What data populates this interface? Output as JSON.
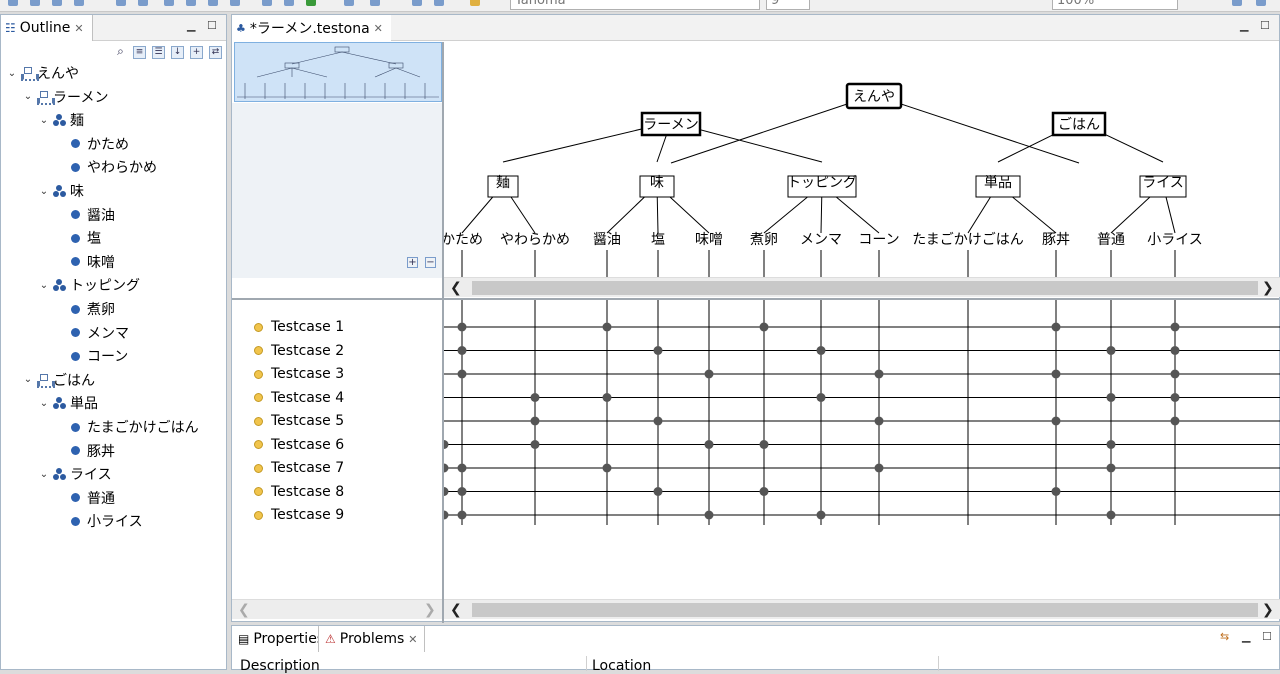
{
  "toolbar": {
    "font_name": "Tahoma",
    "font_size": "9",
    "zoom": "100%"
  },
  "outline": {
    "title": "Outline",
    "tree": [
      {
        "label": "えんや",
        "level": 0,
        "type": "root",
        "expanded": true
      },
      {
        "label": "ラーメン",
        "level": 1,
        "type": "node",
        "expanded": true
      },
      {
        "label": "麺",
        "level": 2,
        "type": "comp",
        "expanded": true
      },
      {
        "label": "かため",
        "level": 3,
        "type": "leaf"
      },
      {
        "label": "やわらかめ",
        "level": 3,
        "type": "leaf"
      },
      {
        "label": "味",
        "level": 2,
        "type": "comp",
        "expanded": true
      },
      {
        "label": "醤油",
        "level": 3,
        "type": "leaf"
      },
      {
        "label": "塩",
        "level": 3,
        "type": "leaf"
      },
      {
        "label": "味噌",
        "level": 3,
        "type": "leaf"
      },
      {
        "label": "トッピング",
        "level": 2,
        "type": "comp",
        "expanded": true
      },
      {
        "label": "煮卵",
        "level": 3,
        "type": "leaf"
      },
      {
        "label": "メンマ",
        "level": 3,
        "type": "leaf"
      },
      {
        "label": "コーン",
        "level": 3,
        "type": "leaf"
      },
      {
        "label": "ごはん",
        "level": 1,
        "type": "node",
        "expanded": true
      },
      {
        "label": "単品",
        "level": 2,
        "type": "comp",
        "expanded": true
      },
      {
        "label": "たまごかけごはん",
        "level": 3,
        "type": "leaf"
      },
      {
        "label": "豚丼",
        "level": 3,
        "type": "leaf"
      },
      {
        "label": "ライス",
        "level": 2,
        "type": "comp",
        "expanded": true
      },
      {
        "label": "普通",
        "level": 3,
        "type": "leaf"
      },
      {
        "label": "小ライス",
        "level": 3,
        "type": "leaf"
      }
    ]
  },
  "editor": {
    "tab_title": "*ラーメン.testona",
    "model": {
      "root": "えんや",
      "groups": [
        {
          "name": "ラーメン",
          "categories": [
            {
              "name": "麺",
              "classes": [
                "かため",
                "やわらかめ"
              ]
            },
            {
              "name": "味",
              "classes": [
                "醤油",
                "塩",
                "味噌"
              ]
            },
            {
              "name": "トッピング",
              "classes": [
                "煮卵",
                "メンマ",
                "コーン"
              ]
            }
          ]
        },
        {
          "name": "ごはん",
          "categories": [
            {
              "name": "単品",
              "classes": [
                "たまごかけごはん",
                "豚丼"
              ]
            },
            {
              "name": "ライス",
              "classes": [
                "普通",
                "小ライス"
              ]
            }
          ]
        }
      ]
    },
    "testcases": [
      {
        "name": "Testcase 1",
        "marks": [
          0,
          2,
          5,
          9,
          11
        ]
      },
      {
        "name": "Testcase 2",
        "marks": [
          0,
          3,
          6,
          10,
          11
        ]
      },
      {
        "name": "Testcase 3",
        "marks": [
          0,
          4,
          7,
          9,
          11
        ]
      },
      {
        "name": "Testcase 4",
        "marks": [
          1,
          2,
          6,
          10,
          11
        ]
      },
      {
        "name": "Testcase 5",
        "marks": [
          1,
          3,
          7,
          9,
          11
        ]
      },
      {
        "name": "Testcase 6",
        "marks": [
          1,
          4,
          5,
          10,
          12
        ]
      },
      {
        "name": "Testcase 7",
        "marks": [
          0,
          2,
          7,
          10,
          12
        ]
      },
      {
        "name": "Testcase 8",
        "marks": [
          0,
          3,
          5,
          9,
          12
        ]
      },
      {
        "name": "Testcase 9",
        "marks": [
          0,
          4,
          6,
          10,
          12
        ]
      }
    ]
  },
  "bottom": {
    "tabs": [
      "Properties",
      "Problems"
    ],
    "columns": [
      "Description",
      "Location"
    ]
  }
}
